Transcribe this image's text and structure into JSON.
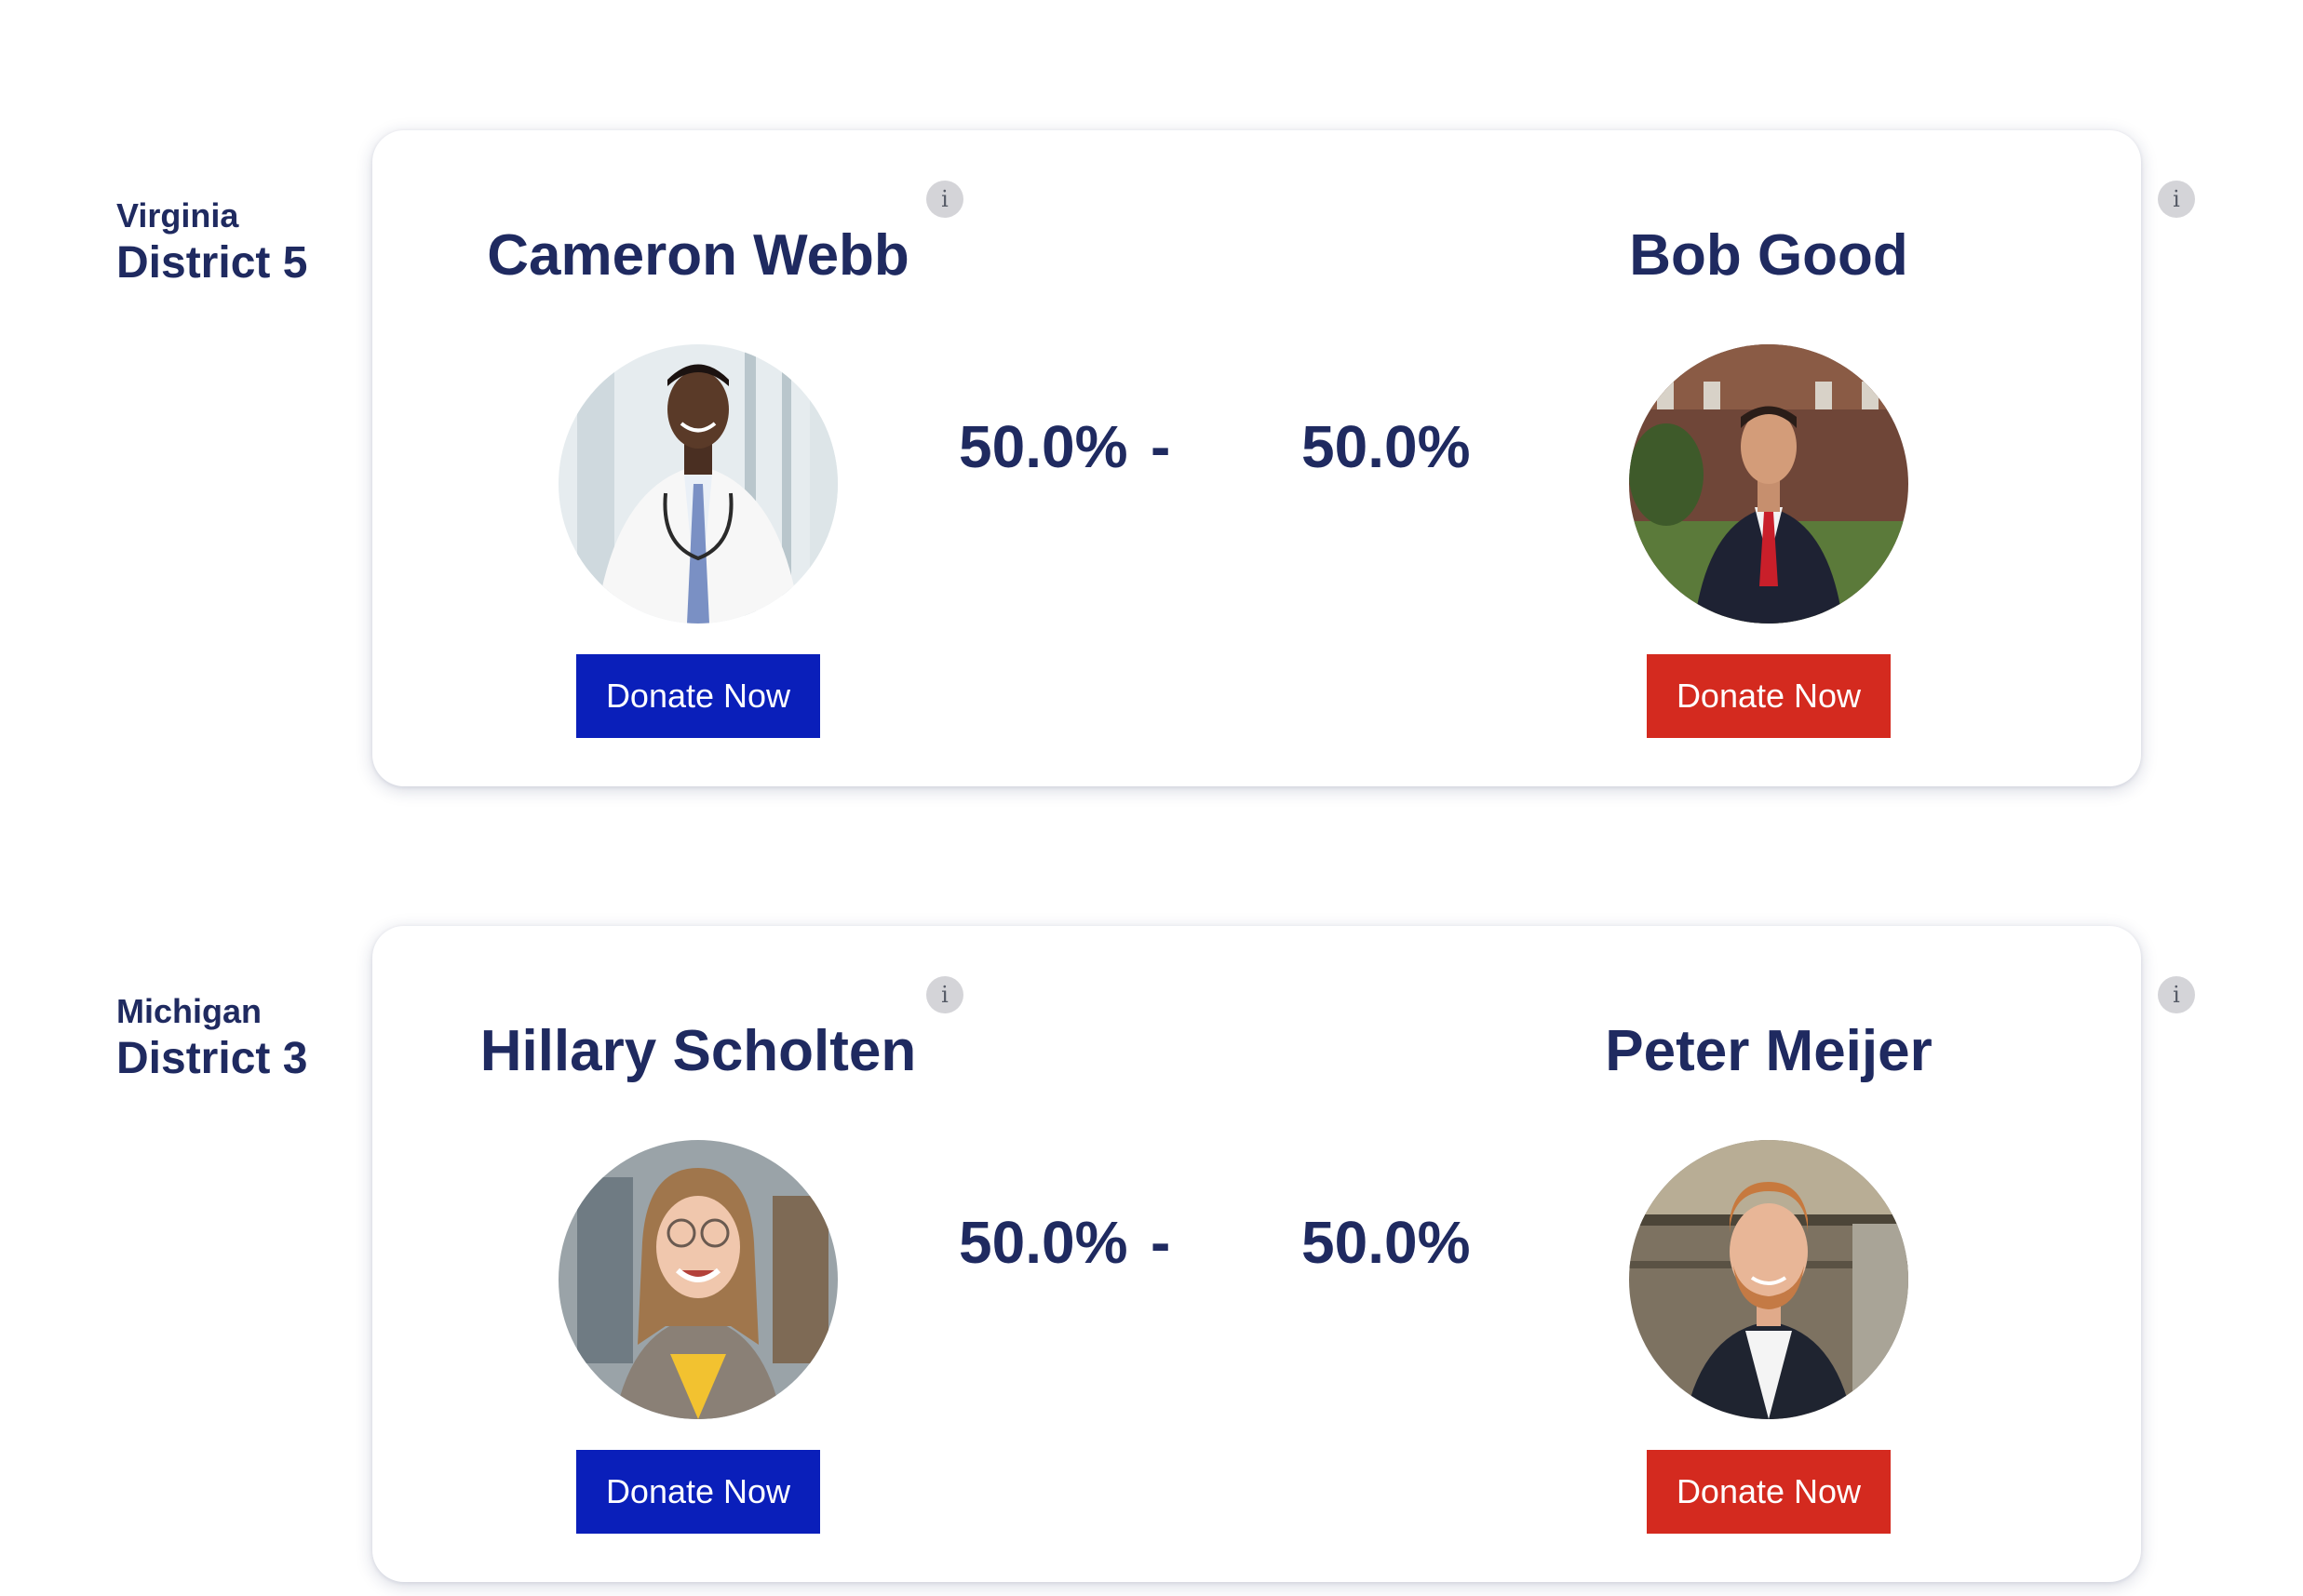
{
  "races": [
    {
      "state": "Virginia",
      "district": "District 5",
      "democrat": {
        "name": "Cameron Webb",
        "percent": "50.0%",
        "donate_label": "Donate Now",
        "info_icon": "i",
        "photo_icon": "candidate-photo"
      },
      "separator": "-",
      "republican": {
        "name": "Bob Good",
        "percent": "50.0%",
        "donate_label": "Donate Now",
        "info_icon": "i",
        "photo_icon": "candidate-photo"
      }
    },
    {
      "state": "Michigan",
      "district": "District 3",
      "democrat": {
        "name": "Hillary Scholten",
        "percent": "50.0%",
        "donate_label": "Donate Now",
        "info_icon": "i",
        "photo_icon": "candidate-photo"
      },
      "separator": "-",
      "republican": {
        "name": "Peter Meijer",
        "percent": "50.0%",
        "donate_label": "Donate Now",
        "info_icon": "i",
        "photo_icon": "candidate-photo"
      }
    }
  ],
  "colors": {
    "text": "#1f2a60",
    "democrat_button": "#0a1fba",
    "republican_button": "#d42a1f",
    "info_icon_bg": "#d4d4d8"
  }
}
